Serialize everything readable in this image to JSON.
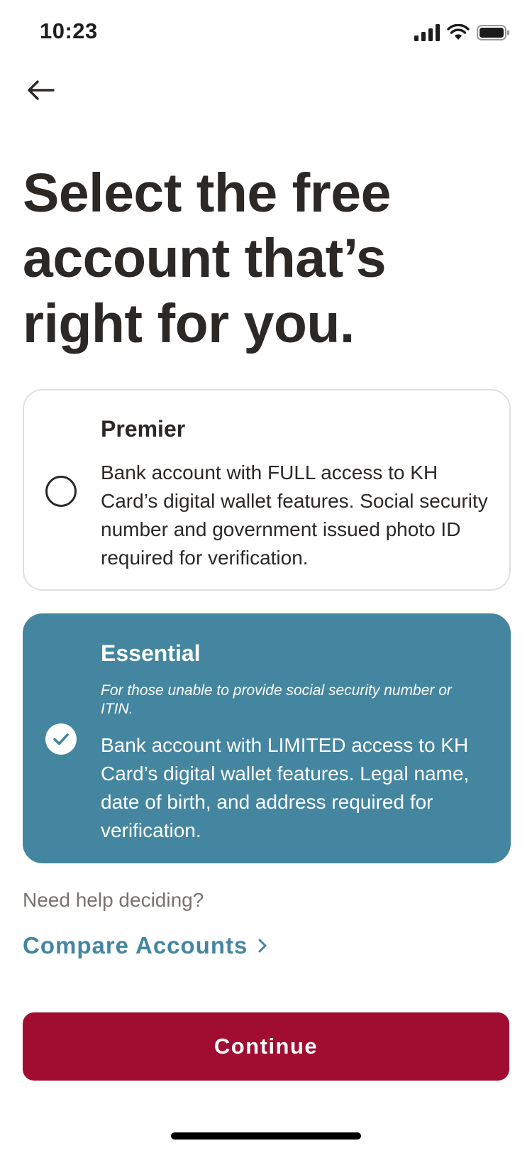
{
  "status_bar": {
    "time": "10:23"
  },
  "header": {
    "back_icon": "arrow-left-icon"
  },
  "page": {
    "title": "Select the free account that’s right for you."
  },
  "accounts": [
    {
      "name": "Premier",
      "selected": false,
      "description": "Bank account with FULL access to KH Card’s digital wallet features. Social security number and government issued photo ID required for verification."
    },
    {
      "name": "Essential",
      "selected": true,
      "note": "For those unable to provide social security number or ITIN.",
      "description": "Bank account with LIMITED access to KH Card’s digital wallet features. Legal name, date of birth, and address required for verification."
    }
  ],
  "help": {
    "text": "Need help deciding?",
    "link_label": "Compare Accounts"
  },
  "actions": {
    "continue_label": "Continue"
  },
  "colors": {
    "accent": "#4486a0",
    "primary_button": "#a10d31",
    "text": "#2b2826"
  }
}
